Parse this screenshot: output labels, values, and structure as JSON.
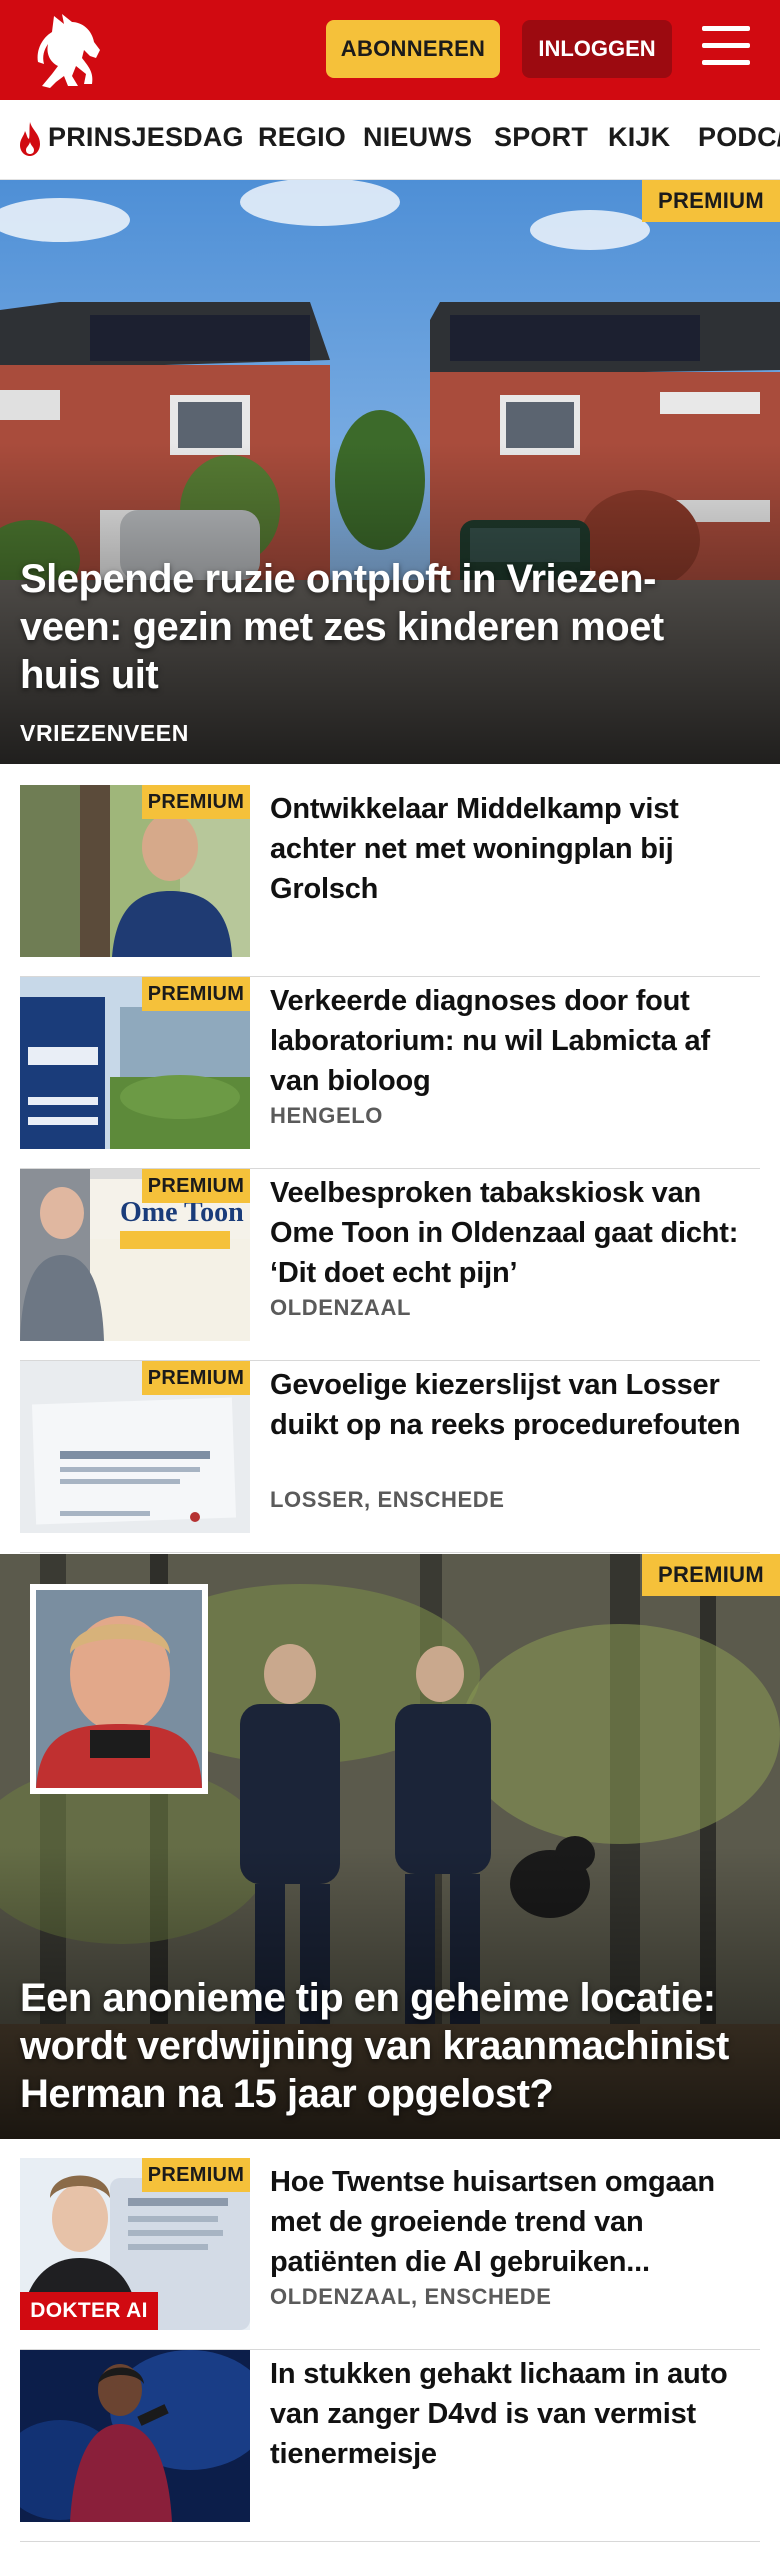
{
  "header": {
    "subscribe_label": "ABONNEREN",
    "login_label": "INLOGGEN",
    "logo_icon": "horse-icon",
    "menu_icon": "hamburger-icon",
    "brand_color": "#d10a11",
    "accent_color": "#f5c13a"
  },
  "nav": {
    "items": [
      {
        "label": "PRINSJESDAG",
        "icon": "flame-icon"
      },
      {
        "label": "REGIO"
      },
      {
        "label": "NIEUWS"
      },
      {
        "label": "SPORT"
      },
      {
        "label": "KIJK"
      },
      {
        "label": "PODC/"
      }
    ]
  },
  "hero1": {
    "badge": "PREMIUM",
    "title": "Slepende ruzie ontploft in Vriezen­veen: gezin met zes kinderen moet huis uit",
    "location": "VRIEZENVEEN"
  },
  "articles1": [
    {
      "badge": "PREMIUM",
      "title": "Ontwikkelaar Middelkamp vist achter net met woningplan bij Grolsch",
      "location": ""
    },
    {
      "badge": "PREMIUM",
      "title": "Verkeerde diagnoses door fout laboratorium: nu wil Labmicta af van bioloog",
      "location": "HENGELO"
    },
    {
      "badge": "PREMIUM",
      "title": "Veelbesproken tabakskiosk van Ome Toon in Oldenzaal gaat dicht: ‘Dit doet echt pijn’",
      "location": "OLDENZAAL"
    },
    {
      "badge": "PREMIUM",
      "title": "Gevoelige kiezerslijst van Losser duikt op na reeks procedurefou­ten",
      "location": "LOSSER, ENSCHEDE"
    }
  ],
  "hero2": {
    "badge": "PREMIUM",
    "title": "Een anonieme tip en geheime locatie: wordt verdwijning van kraanmachi­nist Herman na 15 jaar opgelost?"
  },
  "articles2": [
    {
      "badge": "PREMIUM",
      "tag": "DOKTER AI",
      "title": "Hoe Twentse huisartsen omgaan met de groeiende trend van patiënten die AI gebruiken...",
      "location": "OLDENZAAL, ENSCHEDE"
    },
    {
      "badge": "",
      "title": "In stukken gehakt lichaam in auto van zanger D4vd is van vermist tienermeisje",
      "location": ""
    }
  ]
}
